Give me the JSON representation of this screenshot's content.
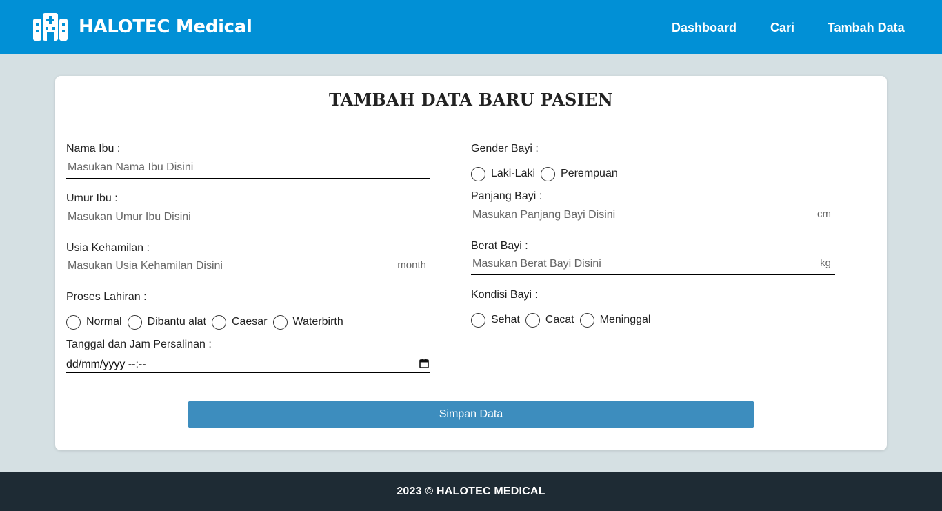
{
  "brand": {
    "name": "HALOTEC Medical",
    "icon": "hospital-icon"
  },
  "nav": {
    "dashboard": "Dashboard",
    "cari": "Cari",
    "tambah": "Tambah Data"
  },
  "colors": {
    "navbar": "#0190d6",
    "page_bg": "#d5e0e3",
    "button": "#3d8dbe",
    "footer": "#1e2b34"
  },
  "form": {
    "title": "TAMBAH DATA BARU PASIEN",
    "nama_ibu": {
      "label": "Nama Ibu :",
      "placeholder": "Masukan Nama Ibu Disini",
      "value": ""
    },
    "umur_ibu": {
      "label": "Umur Ibu :",
      "placeholder": "Masukan Umur Ibu Disini",
      "value": ""
    },
    "usia_kehamilan": {
      "label": "Usia Kehamilan :",
      "placeholder": "Masukan Usia Kehamilan Disini",
      "unit": "month",
      "value": ""
    },
    "proses_lahiran": {
      "label": "Proses Lahiran :",
      "options": [
        "Normal",
        "Dibantu alat",
        "Caesar",
        "Waterbirth"
      ]
    },
    "tanggal": {
      "label": "Tanggal dan Jam Persalinan :",
      "value": "dd/mm/yyyy --:--",
      "icon": "calendar-icon"
    },
    "gender_bayi": {
      "label": "Gender Bayi :",
      "options": [
        "Laki-Laki",
        "Perempuan"
      ]
    },
    "panjang_bayi": {
      "label": "Panjang Bayi :",
      "placeholder": "Masukan Panjang Bayi Disini",
      "unit": "cm",
      "value": ""
    },
    "berat_bayi": {
      "label": "Berat Bayi :",
      "placeholder": "Masukan Berat Bayi Disini",
      "unit": "kg",
      "value": ""
    },
    "kondisi_bayi": {
      "label": "Kondisi Bayi :",
      "options": [
        "Sehat",
        "Cacat",
        "Meninggal"
      ]
    },
    "submit": "Simpan Data"
  },
  "footer": {
    "text": "2023 © HALOTEC MEDICAL"
  }
}
